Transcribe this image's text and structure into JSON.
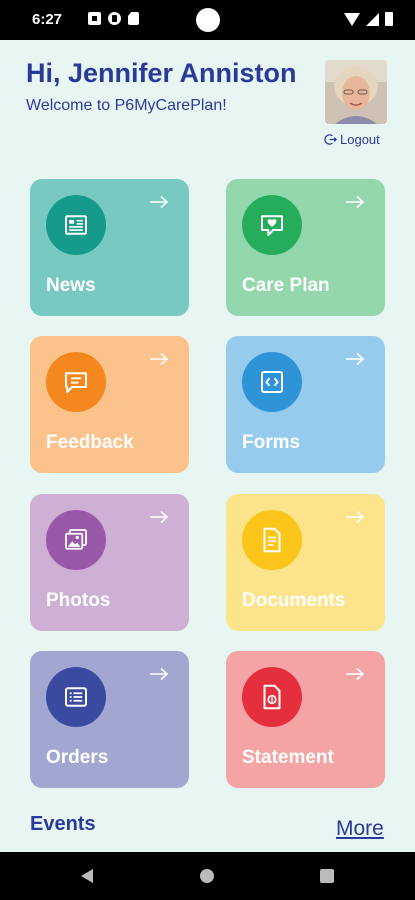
{
  "status_bar": {
    "time": "6:27"
  },
  "header": {
    "greeting": "Hi, Jennifer Anniston",
    "welcome": "Welcome to P6MyCarePlan!",
    "logout_label": "Logout"
  },
  "tiles": [
    {
      "label": "News",
      "icon": "newspaper-icon",
      "bg": "#79c9c3",
      "circle": "#159a8b"
    },
    {
      "label": "Care Plan",
      "icon": "heart-message-icon",
      "bg": "#95d7ad",
      "circle": "#26ad5c"
    },
    {
      "label": "Feedback",
      "icon": "chat-icon",
      "bg": "#fbc28c",
      "circle": "#f5871f"
    },
    {
      "label": "Forms",
      "icon": "code-icon",
      "bg": "#96cbee",
      "circle": "#2f93d7"
    },
    {
      "label": "Photos",
      "icon": "photos-icon",
      "bg": "#ceb0d4",
      "circle": "#9a58a8"
    },
    {
      "label": "Documents",
      "icon": "document-icon",
      "bg": "#fde48b",
      "circle": "#fbc51a"
    },
    {
      "label": "Orders",
      "icon": "list-icon",
      "bg": "#a2a7d2",
      "circle": "#3b4aa1"
    },
    {
      "label": "Statement",
      "icon": "file-dollar-icon",
      "bg": "#f4a4a4",
      "circle": "#e52f3d"
    }
  ],
  "events": {
    "title": "Events",
    "more_label": "More"
  }
}
